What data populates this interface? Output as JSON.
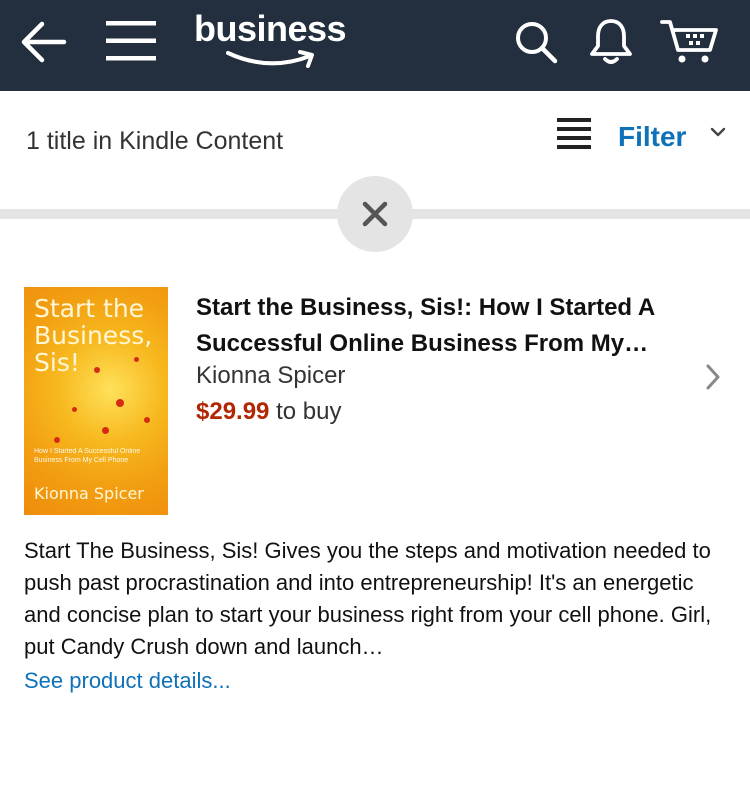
{
  "header": {
    "logo_text": "business",
    "icons": [
      "back-arrow-icon",
      "menu-icon",
      "search-icon",
      "bell-icon",
      "cart-icon"
    ],
    "background_color": "#232f3e"
  },
  "toolbar": {
    "result_count": "1 title in Kindle Content",
    "filter_label": "Filter"
  },
  "product": {
    "cover": {
      "title_lines": [
        "Start the",
        "Business,",
        "Sis!"
      ],
      "subtitle": "How I Started A Successful Online Business From My Cell Phone",
      "author": "Kionna Spicer"
    },
    "title": "Start the Business, Sis!: How I Started A Successful Online Business From My…",
    "author": "Kionna Spicer",
    "price": "$29.99",
    "price_suffix": "to buy",
    "description": "Start The Business, Sis! Gives you the steps and motivation needed to push past procrastination and into entrepreneurship! It's an energetic and concise plan to start your business right from your cell phone. Girl, put Candy Crush down and launch…",
    "details_link": "See product details..."
  },
  "colors": {
    "link": "#0f72b9",
    "price": "#b12704",
    "divider": "#e4e4e4"
  }
}
